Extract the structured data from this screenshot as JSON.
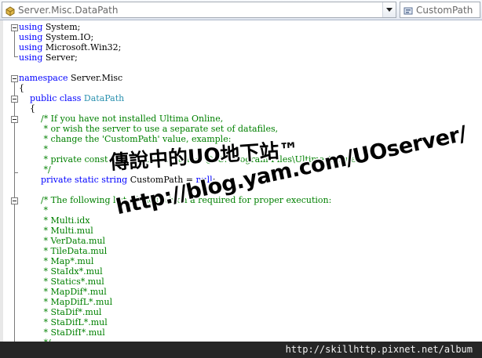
{
  "navigation": {
    "type_selector": {
      "icon": "class-icon",
      "value": "Server.Misc.DataPath"
    },
    "member_selector": {
      "icon": "property-icon",
      "value": "CustomPath"
    }
  },
  "editor": {
    "lines": [
      [
        [
          "kw",
          "using"
        ],
        [
          "pl",
          " System;"
        ]
      ],
      [
        [
          "kw",
          "using"
        ],
        [
          "pl",
          " System.IO;"
        ]
      ],
      [
        [
          "kw",
          "using"
        ],
        [
          "pl",
          " Microsoft.Win32;"
        ]
      ],
      [
        [
          "kw",
          "using"
        ],
        [
          "pl",
          " Server;"
        ]
      ],
      [],
      [
        [
          "kw",
          "namespace"
        ],
        [
          "pl",
          " Server.Misc"
        ]
      ],
      [
        [
          "pl",
          "{"
        ]
      ],
      [
        [
          "pl",
          "    "
        ],
        [
          "kw",
          "public class"
        ],
        [
          "pl",
          " "
        ],
        [
          "typ",
          "DataPath"
        ]
      ],
      [
        [
          "pl",
          "    {"
        ]
      ],
      [
        [
          "pl",
          "        "
        ],
        [
          "cm",
          "/* If you have not installed Ultima Online,"
        ]
      ],
      [
        [
          "pl",
          "         "
        ],
        [
          "cm",
          "* or wish the server to use a separate set of datafiles,"
        ]
      ],
      [
        [
          "pl",
          "         "
        ],
        [
          "cm",
          "* change the 'CustomPath' value, example:"
        ]
      ],
      [
        [
          "pl",
          "         "
        ],
        [
          "cm",
          "*"
        ]
      ],
      [
        [
          "pl",
          "         "
        ],
        [
          "cm",
          "* private const string CustomPath = @\"C:\\Program Files\\Ultima Online\";"
        ]
      ],
      [
        [
          "pl",
          "         "
        ],
        [
          "cm",
          "*/"
        ]
      ],
      [
        [
          "pl",
          "        "
        ],
        [
          "kw",
          "private static string"
        ],
        [
          "pl",
          " CustomPath = "
        ],
        [
          "kw",
          "null"
        ],
        [
          "pl",
          ";"
        ]
      ],
      [],
      [
        [
          "pl",
          "        "
        ],
        [
          "cm",
          "/* The following list of files which a required for proper execution:"
        ]
      ],
      [
        [
          "pl",
          "         "
        ],
        [
          "cm",
          "*"
        ]
      ],
      [
        [
          "pl",
          "         "
        ],
        [
          "cm",
          "* Multi.idx"
        ]
      ],
      [
        [
          "pl",
          "         "
        ],
        [
          "cm",
          "* Multi.mul"
        ]
      ],
      [
        [
          "pl",
          "         "
        ],
        [
          "cm",
          "* VerData.mul"
        ]
      ],
      [
        [
          "pl",
          "         "
        ],
        [
          "cm",
          "* TileData.mul"
        ]
      ],
      [
        [
          "pl",
          "         "
        ],
        [
          "cm",
          "* Map*.mul"
        ]
      ],
      [
        [
          "pl",
          "         "
        ],
        [
          "cm",
          "* StaIdx*.mul"
        ]
      ],
      [
        [
          "pl",
          "         "
        ],
        [
          "cm",
          "* Statics*.mul"
        ]
      ],
      [
        [
          "pl",
          "         "
        ],
        [
          "cm",
          "* MapDif*.mul"
        ]
      ],
      [
        [
          "pl",
          "         "
        ],
        [
          "cm",
          "* MapDifL*.mul"
        ]
      ],
      [
        [
          "pl",
          "         "
        ],
        [
          "cm",
          "* StaDif*.mul"
        ]
      ],
      [
        [
          "pl",
          "         "
        ],
        [
          "cm",
          "* StaDifL*.mul"
        ]
      ],
      [
        [
          "pl",
          "         "
        ],
        [
          "cm",
          "* StaDifI*.mul"
        ]
      ],
      [
        [
          "pl",
          "         "
        ],
        [
          "cm",
          "*/"
        ]
      ]
    ]
  },
  "watermark": {
    "title": "傳說中的UO地下站™",
    "url": "http://blog.yam.com/UOserver/"
  },
  "footer": {
    "text": "http://skillhttp.pixnet.net/album"
  },
  "colors": {
    "keyword": "#0000ff",
    "type": "#2b91af",
    "comment": "#008000",
    "footer_bg": "#262626"
  }
}
